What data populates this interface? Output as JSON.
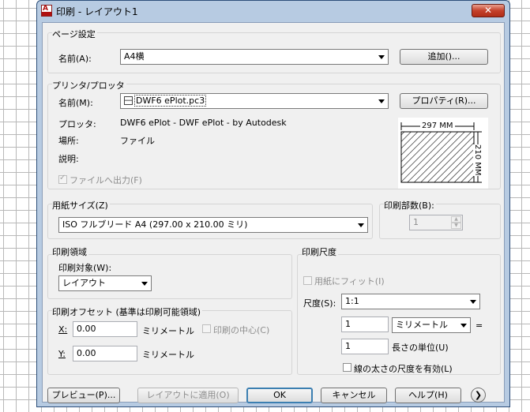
{
  "window": {
    "title": "印刷 - レイアウト1",
    "close": "✕"
  },
  "page_setup": {
    "section": "ページ設定",
    "name_label": "名前(A):",
    "name_value": "A4横",
    "add_button": "追加()..."
  },
  "printer": {
    "section": "プリンタ/プロッタ",
    "name_label": "名前(M):",
    "name_value": "DWF6 ePlot.pc3",
    "properties_button": "プロパティ(R)...",
    "plotter_label": "プロッタ:",
    "plotter_value": "DWF6 ePlot - DWF ePlot - by Autodesk",
    "location_label": "場所:",
    "location_value": "ファイル",
    "description_label": "説明:",
    "print_to_file_label": "ファイルへ出力(F)",
    "preview": {
      "width_label": "297 MM",
      "height_label": "210 MM"
    }
  },
  "paper_size": {
    "section": "用紙サイズ(Z)",
    "value": "ISO フルブリード A4 (297.00 x 210.00 ミリ)"
  },
  "copies": {
    "section": "印刷部数(B):",
    "value": "1"
  },
  "plot_area": {
    "section": "印刷領域",
    "target_label": "印刷対象(W):",
    "target_value": "レイアウト"
  },
  "plot_offset": {
    "section": "印刷オフセット (基準は印刷可能領域)",
    "x_label": "X:",
    "x_value": "0.00",
    "x_unit": "ミリメートル",
    "y_label": "Y:",
    "y_value": "0.00",
    "y_unit": "ミリメートル",
    "center_label": "印刷の中心(C)"
  },
  "plot_scale": {
    "section": "印刷尺度",
    "fit_label": "用紙にフィット(I)",
    "scale_label": "尺度(S):",
    "scale_value": "1:1",
    "value1": "1",
    "unit_value": "ミリメートル",
    "equals": "=",
    "value2": "1",
    "unit_length_label": "長さの単位(U)",
    "lineweight_label": "線の太さの尺度を有効(L)"
  },
  "footer": {
    "preview_button": "プレビュー(P)...",
    "apply_button": "レイアウトに適用(O)",
    "ok_button": "OK",
    "cancel_button": "キャンセル",
    "help_button": "ヘルプ(H)",
    "more_button": "❯"
  }
}
